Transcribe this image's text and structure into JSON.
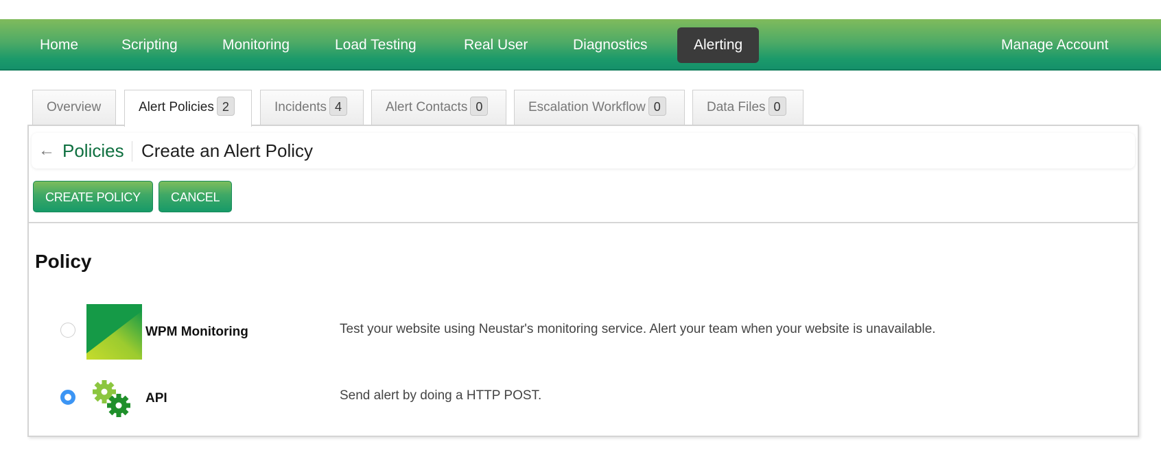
{
  "topnav": {
    "items": [
      {
        "label": "Home",
        "active": false
      },
      {
        "label": "Scripting",
        "active": false
      },
      {
        "label": "Monitoring",
        "active": false
      },
      {
        "label": "Load Testing",
        "active": false
      },
      {
        "label": "Real User",
        "active": false
      },
      {
        "label": "Diagnostics",
        "active": false
      },
      {
        "label": "Alerting",
        "active": true
      }
    ],
    "account_label": "Manage Account"
  },
  "tabs": [
    {
      "label": "Overview",
      "count": null,
      "active": false
    },
    {
      "label": "Alert Policies",
      "count": "2",
      "active": true
    },
    {
      "label": "Incidents",
      "count": "4",
      "active": false
    },
    {
      "label": "Alert Contacts",
      "count": "0",
      "active": false
    },
    {
      "label": "Escalation Workflow",
      "count": "0",
      "active": false
    },
    {
      "label": "Data Files",
      "count": "0",
      "active": false
    }
  ],
  "header": {
    "back_icon": "back-arrow-icon",
    "breadcrumb_link": "Policies",
    "title": "Create an Alert Policy"
  },
  "actions": {
    "create_label": "CREATE POLICY",
    "cancel_label": "CANCEL"
  },
  "policy": {
    "section_title": "Policy",
    "options": [
      {
        "name": "WPM Monitoring",
        "icon": "wpm-logo-icon",
        "description": "Test your website using Neustar's monitoring service. Alert your team when your website is unavailable.",
        "selected": false
      },
      {
        "name": "API",
        "icon": "gears-icon",
        "description": "Send alert by doing a HTTP POST.",
        "selected": true
      }
    ]
  },
  "colors": {
    "nav_green_top": "#80bb5c",
    "nav_green_bottom": "#15906a",
    "active_nav_bg": "#3b3b3b",
    "link_green": "#0e6f3f",
    "radio_selected": "#3c95f4"
  }
}
